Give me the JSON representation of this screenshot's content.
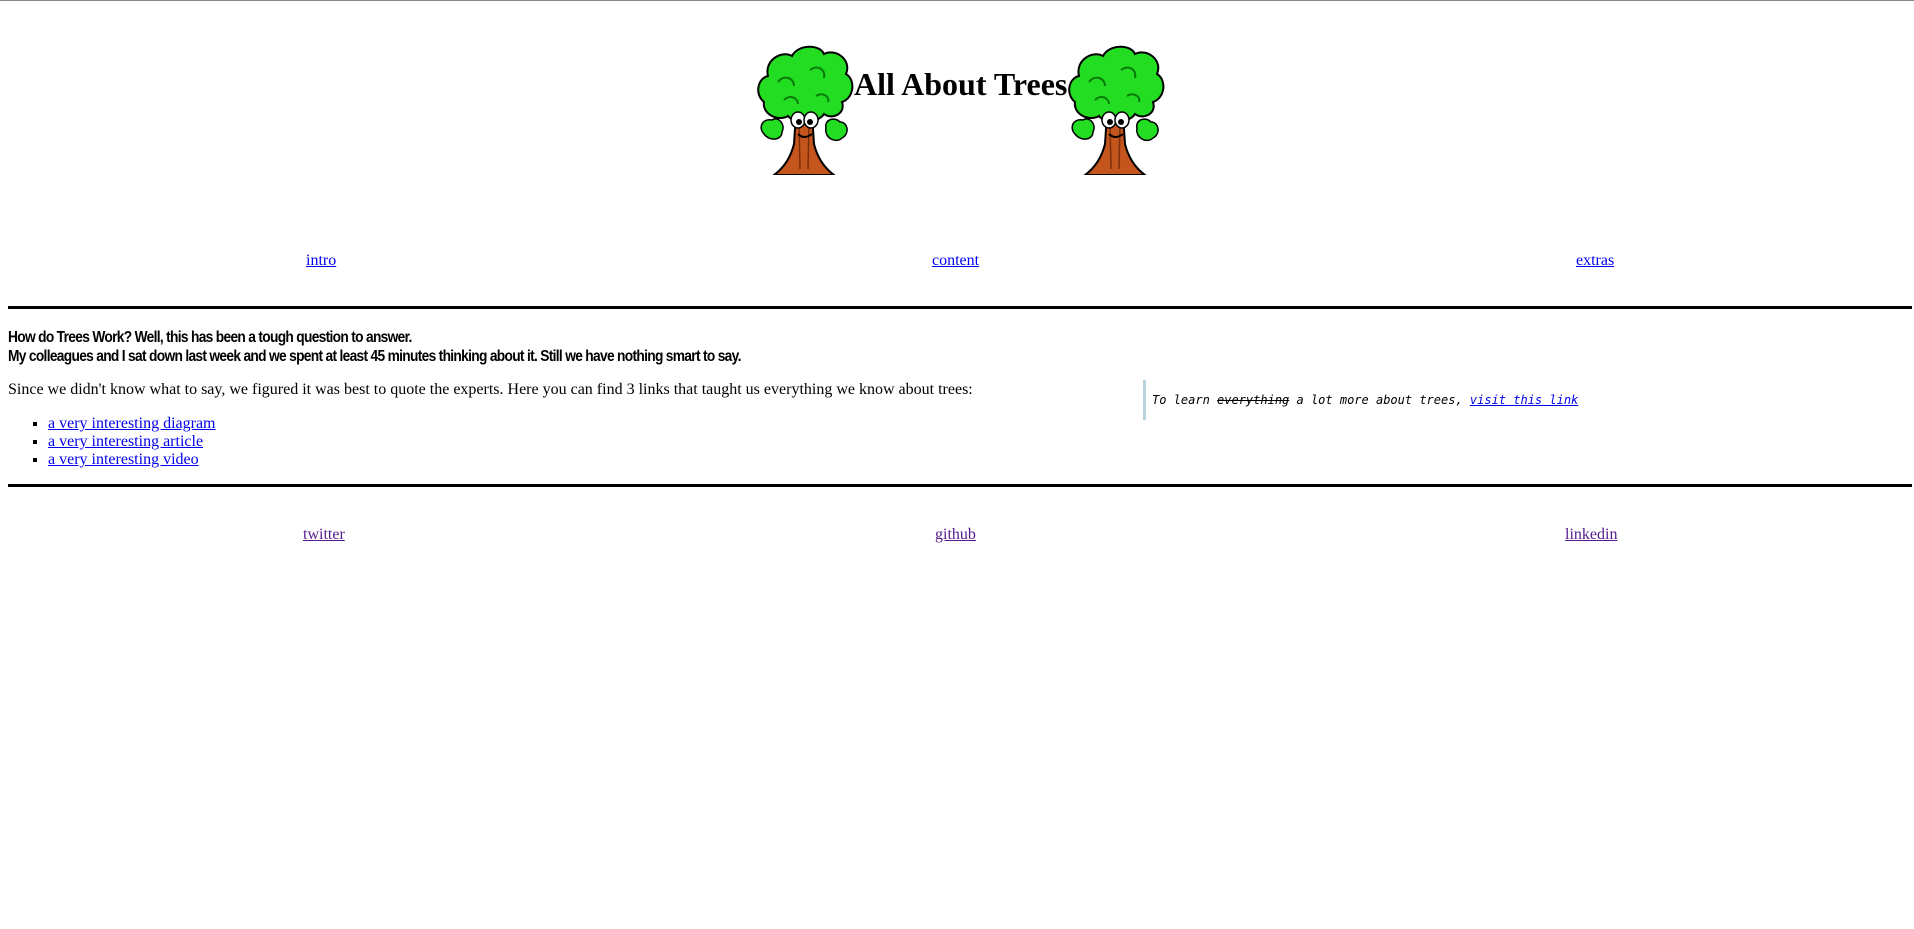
{
  "header": {
    "title": "All About Trees"
  },
  "nav": {
    "items": [
      {
        "label": "intro"
      },
      {
        "label": "content"
      },
      {
        "label": "extras"
      }
    ]
  },
  "main": {
    "question_line1": "How do Trees Work? Well, this has been a tough question to answer.",
    "question_line2": "My colleagues and I sat down last week and we spent at least 45 minutes thinking about it. Still we have nothing smart to say.",
    "intro_text": "Since we didn't know what to say, we figured it was best to quote the experts. Here you can find 3 links that taught us everything we know about trees:",
    "links": [
      {
        "label": "a very interesting diagram"
      },
      {
        "label": "a very interesting article"
      },
      {
        "label": "a very interesting video"
      }
    ]
  },
  "aside": {
    "prefix": "To learn ",
    "struck": "everything",
    "middle": " a lot more about trees, ",
    "link": "visit this link"
  },
  "footer": {
    "links": [
      {
        "label": "twitter"
      },
      {
        "label": "github"
      },
      {
        "label": "linkedin"
      }
    ]
  },
  "colors": {
    "link": "#0000ee",
    "visited_link": "#551a8b",
    "tree_leaves": "#22dd22",
    "tree_trunk": "#c4551c",
    "aside_border": "#b7d3dc"
  }
}
